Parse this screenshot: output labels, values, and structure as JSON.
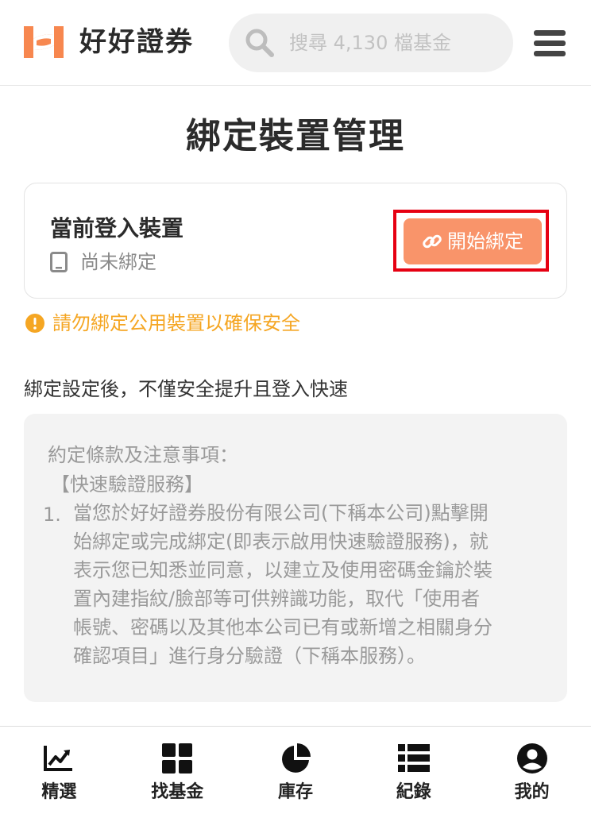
{
  "header": {
    "brand_name": "好好證券",
    "search_placeholder": "搜尋 4,130 檔基金",
    "icons": {
      "logo": "logo-icon",
      "search": "search-icon",
      "menu": "menu-icon"
    }
  },
  "page": {
    "title": "綁定裝置管理"
  },
  "device_card": {
    "title": "當前登入裝置",
    "status": "尚未綁定",
    "status_icon": "tablet-icon",
    "bind_button_label": "開始綁定",
    "bind_button_icon": "link-icon",
    "bind_button_color": "#f9946a",
    "highlight_color": "#e60012"
  },
  "warning": {
    "text": "請勿綁定公用裝置以確保安全",
    "color": "#f5a623",
    "icon": "warning-icon"
  },
  "description": "綁定設定後，不僅安全提升且登入快速",
  "terms": {
    "heading": "約定條款及注意事項：",
    "section": "【快速驗證服務】",
    "item_number": "1.",
    "item_lines": [
      "當您於好好證券股份有限公司(下稱本公司)點擊開",
      "始綁定或完成綁定(即表示啟用快速驗證服務)，就",
      "表示您已知悉並同意，以建立及使用密碼金鑰於裝",
      "置內建指紋/臉部等可供辨識功能，取代「使用者",
      "帳號、密碼以及其他本公司已有或新增之相關身分",
      "確認項目」進行身分驗證（下稱本服務）。"
    ]
  },
  "bottom_nav": {
    "items": [
      {
        "label": "精選",
        "icon": "trending-chart-icon"
      },
      {
        "label": "找基金",
        "icon": "grid-icon"
      },
      {
        "label": "庫存",
        "icon": "pie-chart-icon"
      },
      {
        "label": "紀錄",
        "icon": "list-icon"
      },
      {
        "label": "我的",
        "icon": "account-icon"
      }
    ]
  }
}
